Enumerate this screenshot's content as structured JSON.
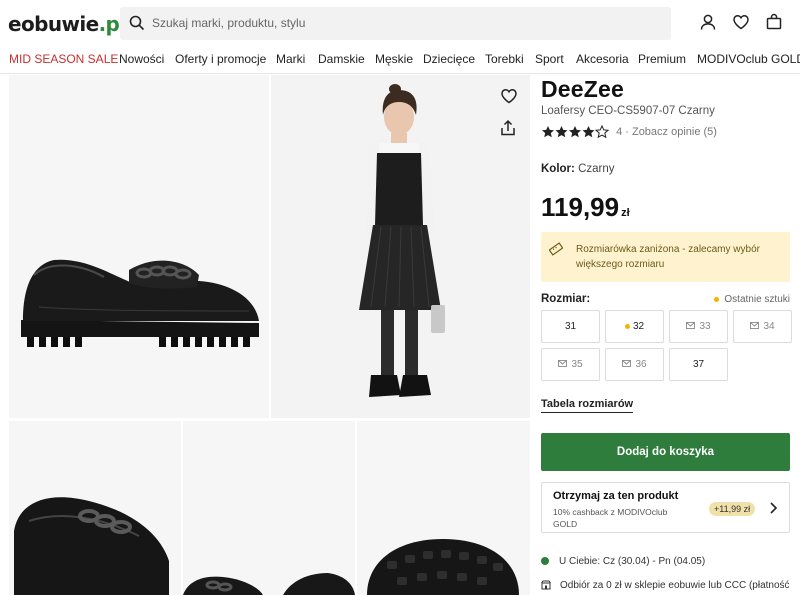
{
  "header": {
    "logo_main": "eobuwie",
    "logo_suffix": ".pl",
    "search_placeholder": "Szukaj marki, produktu, stylu",
    "icons": [
      "search-icon",
      "user-icon",
      "heart-icon",
      "bag-icon"
    ]
  },
  "nav": {
    "items": [
      "MID SEASON SALE",
      "Nowości",
      "Oferty i promocje",
      "Marki",
      "Damskie",
      "Męskie",
      "Dziecięce",
      "Torebki",
      "Sport",
      "Akcesoria",
      "Premium",
      "MODIVOclub GOLD"
    ]
  },
  "gallery": {
    "icons": [
      "heart-icon",
      "share-icon"
    ]
  },
  "product": {
    "brand": "DeeZee",
    "model": "Loafersy CEO-CS5907-07 Czarny",
    "rating_value": 4,
    "rating_text": "4",
    "rating_separator": " · ",
    "reviews_link": "Zobacz opinie (5)",
    "color_label": "Kolor:",
    "color_value": "Czarny",
    "price": "119,99",
    "currency": "zł",
    "notice": "Rozmiarówka zaniżona - zalecamy wybór większego rozmiaru",
    "size_label": "Rozmiar:",
    "last_pieces": "Ostatnie sztuki",
    "sizes": [
      {
        "label": "31",
        "state": "available"
      },
      {
        "label": "32",
        "state": "last"
      },
      {
        "label": "33",
        "state": "notify"
      },
      {
        "label": "34",
        "state": "notify"
      },
      {
        "label": "35",
        "state": "notify"
      },
      {
        "label": "36",
        "state": "notify"
      },
      {
        "label": "37",
        "state": "available"
      }
    ],
    "size_table": "Tabela rozmiarów",
    "add_to_cart": "Dodaj do koszyka",
    "club_title": "Otrzymaj za ten produkt",
    "club_desc": "10% cashback z MODIVOclub GOLD",
    "club_badge": "+11,99 zł",
    "delivery": "U Ciebie: Cz (30.04) - Pn (04.05)",
    "pickup": "Odbiór za 0 zł w sklepie eobuwie lub CCC (płatność"
  },
  "colors": {
    "accent_green": "#2e7d3d",
    "sale_red": "#c8302f",
    "notice_bg": "#fff3cf",
    "warning_dot": "#f0b400"
  }
}
